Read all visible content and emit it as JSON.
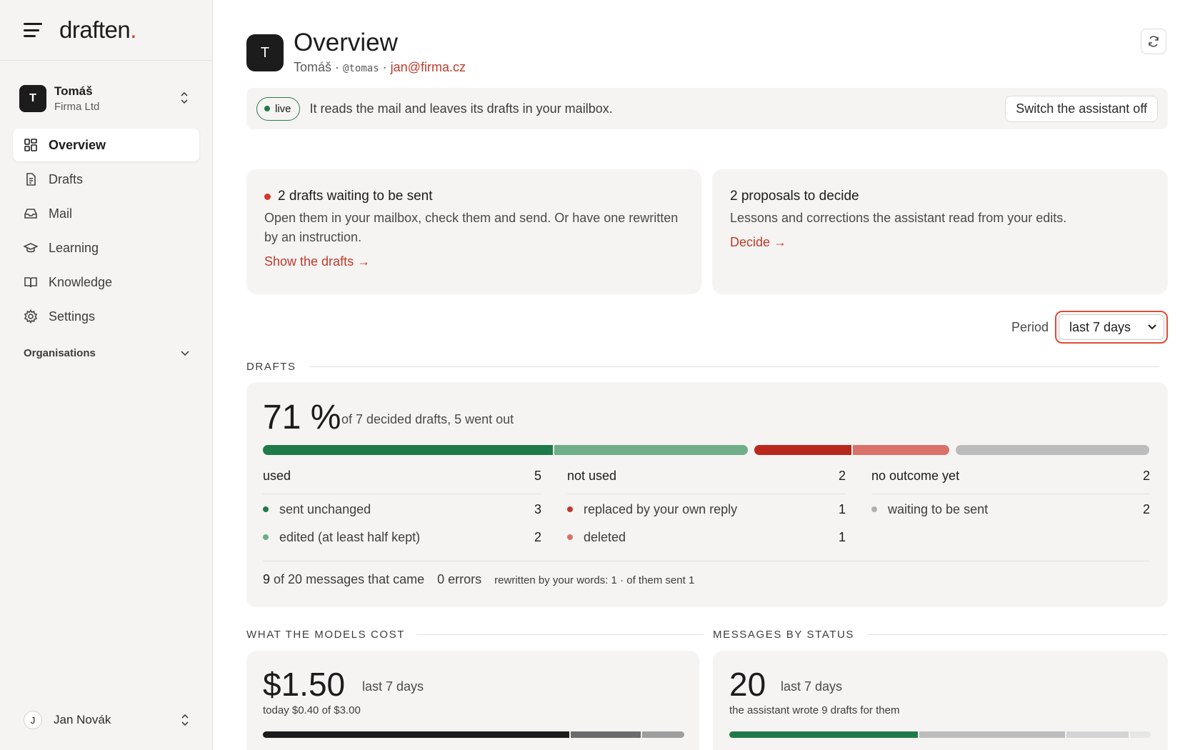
{
  "brand": {
    "name": "draften",
    "dot": "."
  },
  "account": {
    "initial": "T",
    "name": "Tomáš",
    "company": "Firma Ltd"
  },
  "nav": [
    {
      "label": "Overview",
      "icon": "grid-icon",
      "active": true
    },
    {
      "label": "Drafts",
      "icon": "document-icon"
    },
    {
      "label": "Mail",
      "icon": "inbox-icon"
    },
    {
      "label": "Learning",
      "icon": "graduation-cap-icon"
    },
    {
      "label": "Knowledge",
      "icon": "book-icon"
    },
    {
      "label": "Settings",
      "icon": "gear-icon"
    }
  ],
  "organisations_label": "Organisations",
  "user": {
    "initial": "J",
    "name": "Jan Novák"
  },
  "header": {
    "initial": "T",
    "title": "Overview",
    "name": "Tomáš",
    "sep": "·",
    "handle": "@tomas",
    "email": "jan@firma.cz"
  },
  "banner": {
    "badge": "live",
    "text": "It reads the mail and leaves its drafts in your mailbox.",
    "button": "Switch the assistant off"
  },
  "cards": {
    "drafts": {
      "title": "2 drafts waiting to be sent",
      "text": "Open them in your mailbox, check them and send. Or have one rewritten by an instruction.",
      "link": "Show the drafts →"
    },
    "proposals": {
      "title": "2 proposals to decide",
      "text": "Lessons and corrections the assistant read from your edits.",
      "link": "Decide →"
    }
  },
  "period": {
    "label": "Period",
    "selected": "last 7 days"
  },
  "sections": {
    "drafts": "DRAFTS",
    "cost": "WHAT THE MODELS COST",
    "status": "MESSAGES BY STATUS"
  },
  "drafts_stats": {
    "percent": "71 %",
    "note": "of 7 decided drafts, 5 went out",
    "bar_segments": [
      {
        "name": "sent unchanged",
        "value": 3,
        "color": "#1f7a4a"
      },
      {
        "name": "edited",
        "value": 2,
        "color": "#6fae88"
      },
      {
        "name": "replaced",
        "value": 1,
        "color": "#b8281d"
      },
      {
        "name": "deleted",
        "value": 1,
        "color": "#d9726a"
      },
      {
        "name": "waiting",
        "value": 2,
        "color": "#bcbcbc"
      }
    ],
    "columns": [
      {
        "title": "used",
        "total": "5",
        "rows": [
          {
            "label": "sent unchanged",
            "value": "3",
            "color": "#1f7a4a"
          },
          {
            "label": "edited (at least half kept)",
            "value": "2",
            "color": "#6fae88"
          }
        ]
      },
      {
        "title": "not used",
        "total": "2",
        "rows": [
          {
            "label": "replaced by your own reply",
            "value": "1",
            "color": "#c0392b"
          },
          {
            "label": "deleted",
            "value": "1",
            "color": "#d9726a"
          }
        ]
      },
      {
        "title": "no outcome yet",
        "total": "2",
        "rows": [
          {
            "label": "waiting to be sent",
            "value": "2",
            "color": "#b0b0b0"
          }
        ]
      }
    ],
    "footer": {
      "count": "9",
      "messages": "of 20 messages that came",
      "errors": "0 errors",
      "rewritten": "rewritten by your words: 1 · of them sent 1"
    }
  },
  "cost": {
    "value": "$1.50",
    "period": "last 7 days",
    "sub": "today $0.40 of $3.00",
    "segments": [
      {
        "value": 0.73,
        "color": "#1c1c1c"
      },
      {
        "value": 0.17,
        "color": "#6b6b6b"
      },
      {
        "value": 0.1,
        "color": "#9e9e9e"
      }
    ]
  },
  "status": {
    "value": "20",
    "period": "last 7 days",
    "sub": "the assistant wrote 9 drafts for them",
    "segments": [
      {
        "value": 0.45,
        "color": "#1f7a4a"
      },
      {
        "value": 0.35,
        "color": "#bdbdbd"
      },
      {
        "value": 0.15,
        "color": "#d4d4d4"
      },
      {
        "value": 0.05,
        "color": "#e6e6e6"
      }
    ]
  }
}
